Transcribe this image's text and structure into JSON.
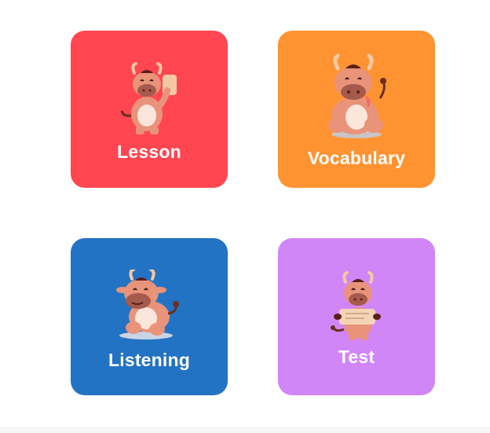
{
  "tiles": [
    {
      "id": "lesson",
      "label": "Lesson",
      "color": "#FF4651",
      "icon": "cow-holding-card-icon"
    },
    {
      "id": "vocabulary",
      "label": "Vocabulary",
      "color": "#FF9331",
      "icon": "cow-sitting-flower-icon"
    },
    {
      "id": "listening",
      "label": "Listening",
      "color": "#2373C4",
      "icon": "cow-sitting-listening-icon"
    },
    {
      "id": "test",
      "label": "Test",
      "color": "#D186F7",
      "icon": "cow-reading-scroll-icon"
    }
  ]
}
